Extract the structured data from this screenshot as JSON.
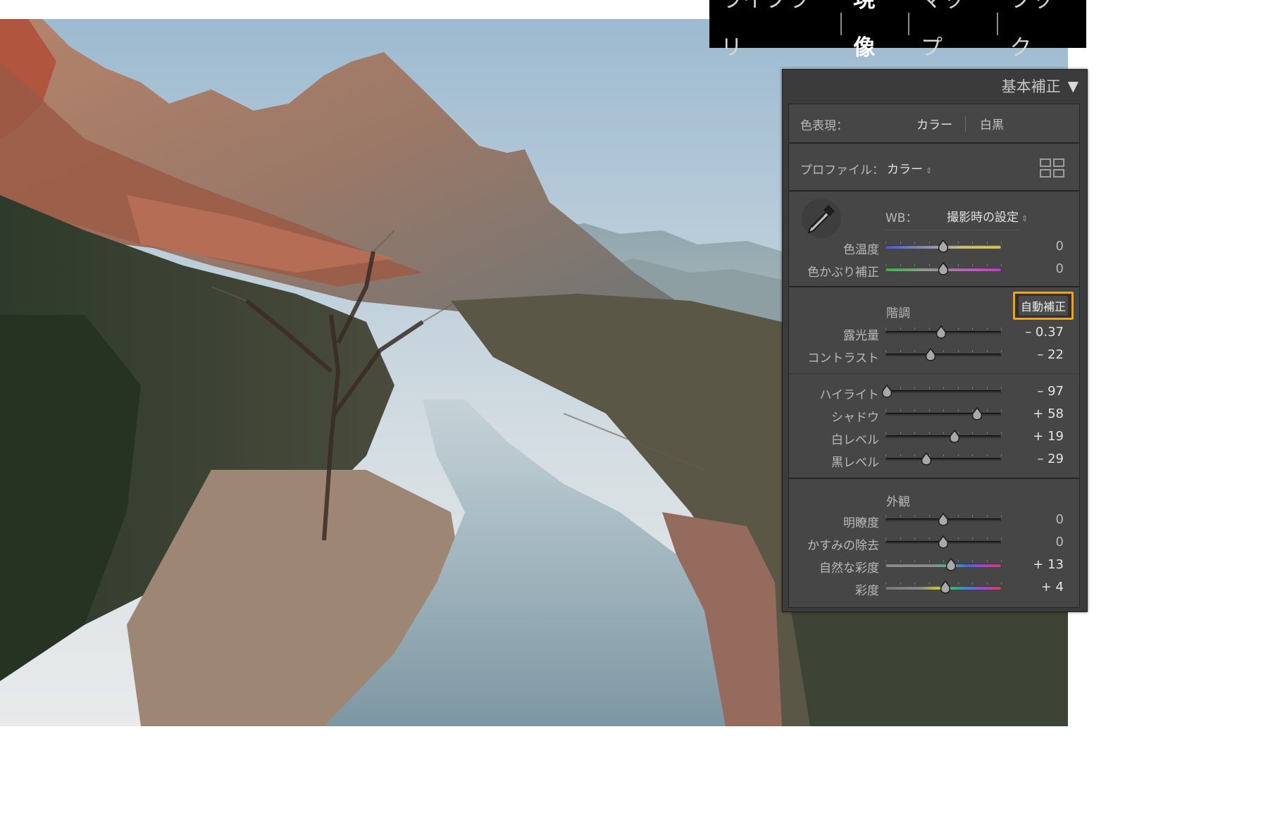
{
  "modules": {
    "tabs": [
      {
        "label": "ライブラリ",
        "active": false
      },
      {
        "label": "現像",
        "active": true
      },
      {
        "label": "マップ",
        "active": false
      },
      {
        "label": "ブック",
        "active": false
      }
    ]
  },
  "panel": {
    "title": "基本補正",
    "collapse_icon": "disclosure-triangle-down-icon",
    "treatment": {
      "label": "色表現：",
      "color": "カラー",
      "bw": "白黒",
      "selected": "カラー"
    },
    "profile": {
      "label": "プロファイル：",
      "value": "カラー",
      "browser_icon": "profile-grid-icon"
    },
    "wb": {
      "picker_icon": "eyedropper-icon",
      "label": "WB：",
      "value": "撮影時の設定",
      "sliders": [
        {
          "label": "色温度",
          "value": "0",
          "position": 0.5,
          "track": "temp"
        },
        {
          "label": "色かぶり補正",
          "value": "0",
          "position": 0.5,
          "track": "tint"
        }
      ]
    },
    "tone": {
      "heading": "階調",
      "auto_label": "自動補正",
      "sliders": [
        {
          "label": "露光量",
          "value": "– 0.37",
          "position": 0.4815,
          "track": "gray"
        },
        {
          "label": "コントラスト",
          "value": "– 22",
          "position": 0.39,
          "track": "gray"
        }
      ],
      "sliders2": [
        {
          "label": "ハイライト",
          "value": "– 97",
          "position": 0.015,
          "track": "gray"
        },
        {
          "label": "シャドウ",
          "value": "+ 58",
          "position": 0.79,
          "track": "gray"
        },
        {
          "label": "白レベル",
          "value": "+ 19",
          "position": 0.595,
          "track": "gray"
        },
        {
          "label": "黒レベル",
          "value": "– 29",
          "position": 0.355,
          "track": "gray"
        }
      ]
    },
    "presence": {
      "heading": "外観",
      "sliders": [
        {
          "label": "明瞭度",
          "value": "0",
          "position": 0.5,
          "track": "gray"
        },
        {
          "label": "かすみの除去",
          "value": "0",
          "position": 0.5,
          "track": "gray"
        },
        {
          "label": "自然な彩度",
          "value": "+ 13",
          "position": 0.565,
          "track": "vib"
        },
        {
          "label": "彩度",
          "value": "+ 4",
          "position": 0.52,
          "track": "sat"
        }
      ]
    }
  },
  "colors": {
    "accent": "#f0a21c",
    "panel_bg": "#3b3b3b",
    "section_bg": "#464646",
    "module_bar_bg": "#000000"
  }
}
